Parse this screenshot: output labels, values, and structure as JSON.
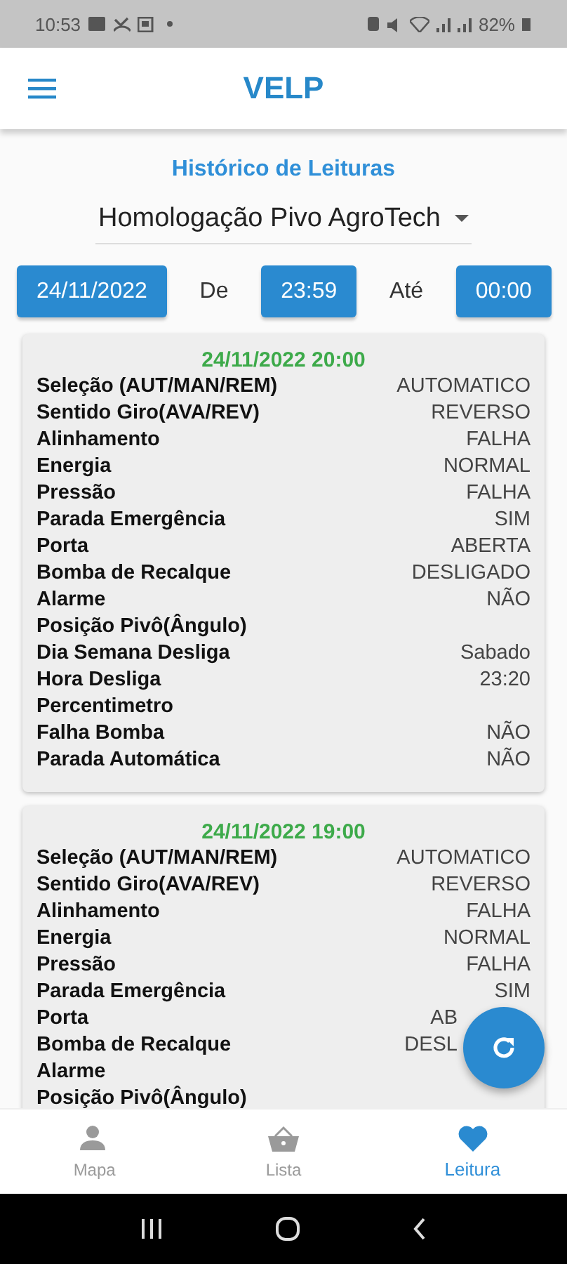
{
  "status_bar": {
    "time": "10:53",
    "battery": "82%"
  },
  "header": {
    "title": "VELP"
  },
  "section_title": "Histórico de Leituras",
  "device_select": {
    "value": "Homologação Pivo AgroTech"
  },
  "filters": [
    {
      "kind": "button",
      "text": "24/11/2022"
    },
    {
      "kind": "label",
      "text": "De"
    },
    {
      "kind": "button",
      "text": "23:59"
    },
    {
      "kind": "label",
      "text": "Até"
    },
    {
      "kind": "button",
      "text": "00:00"
    }
  ],
  "readings": [
    {
      "timestamp": "24/11/2022 20:00",
      "rows": [
        {
          "kind": "full",
          "label": "Seleção (AUT/MAN/REM)",
          "value": "AUTOMATICO"
        },
        {
          "kind": "full",
          "label": "Sentido Giro(AVA/REV)",
          "value": "REVERSO"
        },
        {
          "kind": "full",
          "label": "Alinhamento",
          "value": "FALHA"
        },
        {
          "kind": "full",
          "label": "Energia",
          "value": "NORMAL"
        },
        {
          "kind": "full",
          "label": "Pressão",
          "value": "FALHA"
        },
        {
          "kind": "full",
          "label": "Parada Emergência",
          "value": "SIM"
        },
        {
          "kind": "full",
          "label": "Porta",
          "value": "ABERTA"
        },
        {
          "kind": "full",
          "label": "Bomba de Recalque",
          "value": "DESLIGADO"
        },
        {
          "kind": "full",
          "label": "Alarme",
          "value": "NÃO"
        },
        {
          "kind": "blank",
          "label": "Posição Pivô(Ângulo)"
        },
        {
          "kind": "full",
          "label": "Dia Semana Desliga",
          "value": "Sabado"
        },
        {
          "kind": "full",
          "label": "Hora Desliga",
          "value": "23:20"
        },
        {
          "kind": "blank",
          "label": "Percentimetro"
        },
        {
          "kind": "full",
          "label": "Falha Bomba",
          "value": "NÃO"
        },
        {
          "kind": "full",
          "label": "Parada Automática",
          "value": "NÃO"
        }
      ]
    },
    {
      "timestamp": "24/11/2022 19:00",
      "rows": [
        {
          "kind": "full",
          "label": "Seleção (AUT/MAN/REM)",
          "value": "AUTOMATICO"
        },
        {
          "kind": "full",
          "label": "Sentido Giro(AVA/REV)",
          "value": "REVERSO"
        },
        {
          "kind": "full",
          "label": "Alinhamento",
          "value": "FALHA"
        },
        {
          "kind": "full",
          "label": "Energia",
          "value": "NORMAL"
        },
        {
          "kind": "full",
          "label": "Pressão",
          "value": "FALHA"
        },
        {
          "kind": "full",
          "label": "Parada Emergência",
          "value": "SIM"
        },
        {
          "kind": "covered",
          "label": "Porta",
          "value": "AB"
        },
        {
          "kind": "covered",
          "label": "Bomba de Recalque",
          "value": "DESL"
        },
        {
          "kind": "blank",
          "label": "Alarme"
        },
        {
          "kind": "blank",
          "label": "Posição Pivô(Ângulo)"
        }
      ]
    }
  ],
  "bottom_nav": [
    {
      "label": "Mapa",
      "selected": false
    },
    {
      "label": "Lista",
      "selected": false
    },
    {
      "label": "Leitura",
      "selected": true
    }
  ]
}
